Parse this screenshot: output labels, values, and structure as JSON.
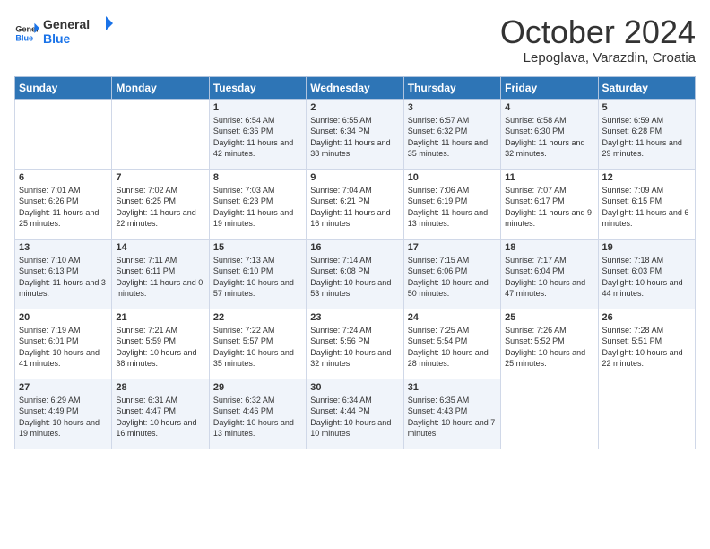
{
  "header": {
    "logo_general": "General",
    "logo_blue": "Blue",
    "month": "October 2024",
    "location": "Lepoglava, Varazdin, Croatia"
  },
  "days_of_week": [
    "Sunday",
    "Monday",
    "Tuesday",
    "Wednesday",
    "Thursday",
    "Friday",
    "Saturday"
  ],
  "weeks": [
    [
      {
        "day": "",
        "info": ""
      },
      {
        "day": "",
        "info": ""
      },
      {
        "day": "1",
        "info": "Sunrise: 6:54 AM\nSunset: 6:36 PM\nDaylight: 11 hours and 42 minutes."
      },
      {
        "day": "2",
        "info": "Sunrise: 6:55 AM\nSunset: 6:34 PM\nDaylight: 11 hours and 38 minutes."
      },
      {
        "day": "3",
        "info": "Sunrise: 6:57 AM\nSunset: 6:32 PM\nDaylight: 11 hours and 35 minutes."
      },
      {
        "day": "4",
        "info": "Sunrise: 6:58 AM\nSunset: 6:30 PM\nDaylight: 11 hours and 32 minutes."
      },
      {
        "day": "5",
        "info": "Sunrise: 6:59 AM\nSunset: 6:28 PM\nDaylight: 11 hours and 29 minutes."
      }
    ],
    [
      {
        "day": "6",
        "info": "Sunrise: 7:01 AM\nSunset: 6:26 PM\nDaylight: 11 hours and 25 minutes."
      },
      {
        "day": "7",
        "info": "Sunrise: 7:02 AM\nSunset: 6:25 PM\nDaylight: 11 hours and 22 minutes."
      },
      {
        "day": "8",
        "info": "Sunrise: 7:03 AM\nSunset: 6:23 PM\nDaylight: 11 hours and 19 minutes."
      },
      {
        "day": "9",
        "info": "Sunrise: 7:04 AM\nSunset: 6:21 PM\nDaylight: 11 hours and 16 minutes."
      },
      {
        "day": "10",
        "info": "Sunrise: 7:06 AM\nSunset: 6:19 PM\nDaylight: 11 hours and 13 minutes."
      },
      {
        "day": "11",
        "info": "Sunrise: 7:07 AM\nSunset: 6:17 PM\nDaylight: 11 hours and 9 minutes."
      },
      {
        "day": "12",
        "info": "Sunrise: 7:09 AM\nSunset: 6:15 PM\nDaylight: 11 hours and 6 minutes."
      }
    ],
    [
      {
        "day": "13",
        "info": "Sunrise: 7:10 AM\nSunset: 6:13 PM\nDaylight: 11 hours and 3 minutes."
      },
      {
        "day": "14",
        "info": "Sunrise: 7:11 AM\nSunset: 6:11 PM\nDaylight: 11 hours and 0 minutes."
      },
      {
        "day": "15",
        "info": "Sunrise: 7:13 AM\nSunset: 6:10 PM\nDaylight: 10 hours and 57 minutes."
      },
      {
        "day": "16",
        "info": "Sunrise: 7:14 AM\nSunset: 6:08 PM\nDaylight: 10 hours and 53 minutes."
      },
      {
        "day": "17",
        "info": "Sunrise: 7:15 AM\nSunset: 6:06 PM\nDaylight: 10 hours and 50 minutes."
      },
      {
        "day": "18",
        "info": "Sunrise: 7:17 AM\nSunset: 6:04 PM\nDaylight: 10 hours and 47 minutes."
      },
      {
        "day": "19",
        "info": "Sunrise: 7:18 AM\nSunset: 6:03 PM\nDaylight: 10 hours and 44 minutes."
      }
    ],
    [
      {
        "day": "20",
        "info": "Sunrise: 7:19 AM\nSunset: 6:01 PM\nDaylight: 10 hours and 41 minutes."
      },
      {
        "day": "21",
        "info": "Sunrise: 7:21 AM\nSunset: 5:59 PM\nDaylight: 10 hours and 38 minutes."
      },
      {
        "day": "22",
        "info": "Sunrise: 7:22 AM\nSunset: 5:57 PM\nDaylight: 10 hours and 35 minutes."
      },
      {
        "day": "23",
        "info": "Sunrise: 7:24 AM\nSunset: 5:56 PM\nDaylight: 10 hours and 32 minutes."
      },
      {
        "day": "24",
        "info": "Sunrise: 7:25 AM\nSunset: 5:54 PM\nDaylight: 10 hours and 28 minutes."
      },
      {
        "day": "25",
        "info": "Sunrise: 7:26 AM\nSunset: 5:52 PM\nDaylight: 10 hours and 25 minutes."
      },
      {
        "day": "26",
        "info": "Sunrise: 7:28 AM\nSunset: 5:51 PM\nDaylight: 10 hours and 22 minutes."
      }
    ],
    [
      {
        "day": "27",
        "info": "Sunrise: 6:29 AM\nSunset: 4:49 PM\nDaylight: 10 hours and 19 minutes."
      },
      {
        "day": "28",
        "info": "Sunrise: 6:31 AM\nSunset: 4:47 PM\nDaylight: 10 hours and 16 minutes."
      },
      {
        "day": "29",
        "info": "Sunrise: 6:32 AM\nSunset: 4:46 PM\nDaylight: 10 hours and 13 minutes."
      },
      {
        "day": "30",
        "info": "Sunrise: 6:34 AM\nSunset: 4:44 PM\nDaylight: 10 hours and 10 minutes."
      },
      {
        "day": "31",
        "info": "Sunrise: 6:35 AM\nSunset: 4:43 PM\nDaylight: 10 hours and 7 minutes."
      },
      {
        "day": "",
        "info": ""
      },
      {
        "day": "",
        "info": ""
      }
    ]
  ]
}
